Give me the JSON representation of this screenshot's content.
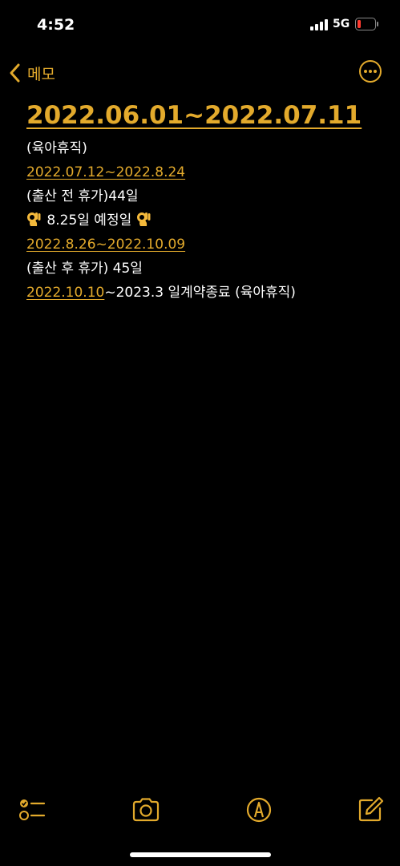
{
  "status_bar": {
    "time": "4:52",
    "network": "5G",
    "battery_color": "#ff3b30"
  },
  "nav": {
    "back_label": "메모",
    "accent_color": "#e3aa2c",
    "back_icon": "chevron-left-icon",
    "more_icon": "ellipsis-circle-icon"
  },
  "note": {
    "title": "2022.06.01~2022.07.11",
    "lines": [
      {
        "text": "(육아휴직)"
      },
      {
        "link": "2022.07.12~2022.8.24"
      },
      {
        "text": "(출산 전 휴가)44일"
      },
      {
        "text": "8.25일 예정일",
        "emoji": "ok-hand-emoji"
      },
      {
        "link": "2022.8.26~2022.10.09"
      },
      {
        "text": "(출산 후 휴가) 45일"
      },
      {
        "link": "2022.10.10",
        "text": "~2023.3 일계약종료 (육아휴직)"
      }
    ]
  },
  "toolbar": {
    "icons": [
      "checklist-icon",
      "camera-icon",
      "markup-pen-icon",
      "compose-icon"
    ]
  }
}
